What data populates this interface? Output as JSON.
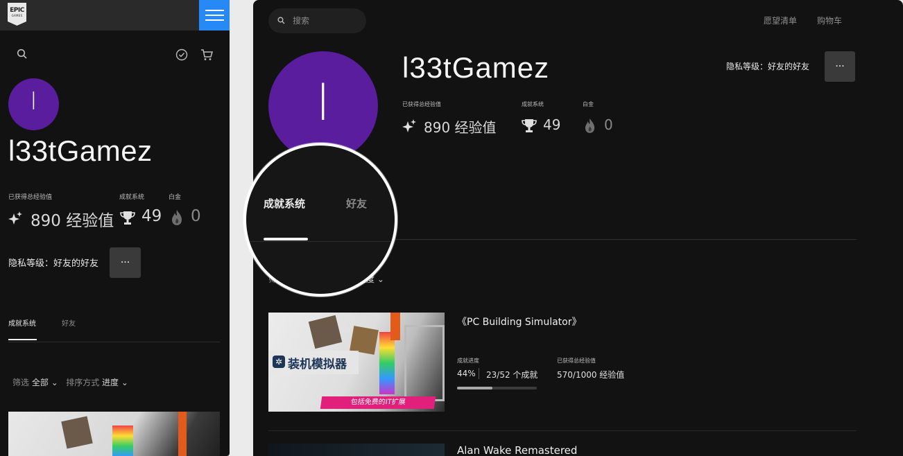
{
  "colors": {
    "accent_blue": "#2689f5",
    "avatar_purple": "#5a1d9e",
    "background": "#121212"
  },
  "logo": {
    "line1": "EPIC",
    "line2": "GAMES"
  },
  "profile": {
    "avatar_letter": "l",
    "username": "l33tGamez",
    "stats": {
      "xp_label": "已获得总经验值",
      "xp_value": "890 经验值",
      "achievements_label": "成就系统",
      "achievements_value": "49",
      "platinum_label": "白金",
      "platinum_value": "0"
    },
    "privacy": "隐私等级：好友的好友",
    "more_label": "···"
  },
  "tabs": [
    {
      "label": "成就系统",
      "active": true
    },
    {
      "label": "好友",
      "active": false
    }
  ],
  "filters": {
    "filter_label": "筛选",
    "filter_value": "全部",
    "sort_label": "排序方式",
    "sort_value": "进度"
  },
  "header": {
    "search_placeholder": "搜索",
    "wishlist": "愿望清单",
    "cart": "购物车"
  },
  "games": [
    {
      "title": "《PC Building Simulator》",
      "image_text": "装机模拟器",
      "image_banner": "包括免费的IT扩展",
      "progress_label": "成就进度",
      "progress_percent": "44%",
      "progress_fraction": 0.44,
      "achievements": "23/52 个成就",
      "xp_label": "已获得总经验值",
      "xp_value": "570/1000 经验值"
    },
    {
      "title": "Alan Wake Remastered"
    }
  ],
  "icons": {
    "search": "search-icon",
    "check": "check-circle-icon",
    "cart": "cart-icon",
    "menu": "hamburger-menu-icon",
    "sparkle": "sparkle-icon",
    "trophy": "trophy-icon",
    "platinum": "flame-icon"
  }
}
